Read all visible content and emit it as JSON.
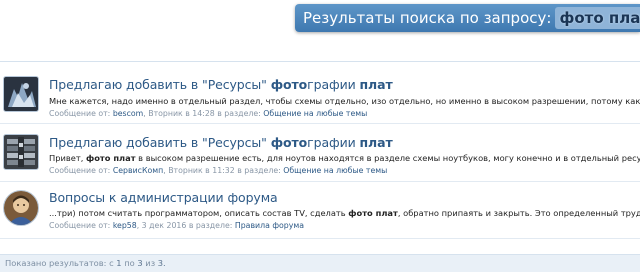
{
  "header": {
    "title_prefix": "Результаты поиска по запросу:",
    "query": "фото плат"
  },
  "results": [
    {
      "title_parts": [
        "Предлагаю добавить в \"Ресурсы\" ",
        "фото",
        "графии ",
        "плат"
      ],
      "snippet_parts": [
        "Мне кажется, надо именно в отдельный раздел, чтобы схемы отдельно, изо отдельно, но именно в высоком разрешении, потому как в плохом качест"
      ],
      "meta": {
        "message_from_label": "Сообщение от:",
        "author": "bescom",
        "date": ", Вторник в 14:28",
        "section_label": "в разделе:",
        "forum": "Общение на любые темы"
      }
    },
    {
      "title_parts": [
        "Предлагаю добавить в \"Ресурсы\" ",
        "фото",
        "графии ",
        "плат"
      ],
      "snippet_parts": [
        "Привет, ",
        "фото плат",
        " в высоком разрешение есть, для ноутов находятся в разделе схемы ноутбуков, могу конечно и в отдельный ресурс вынести, как т"
      ],
      "meta": {
        "message_from_label": "Сообщение от:",
        "author": "СервисКомп",
        "date": ", Вторник в 11:32",
        "section_label": "в разделе:",
        "forum": "Общение на любые темы"
      }
    },
    {
      "title_parts": [
        "Вопросы к администрации форума"
      ],
      "snippet_parts": [
        "...три) потом считать программатором, описать состав TV, сделать ",
        "фото плат",
        ", обратно припаять и закрыть. Это определенный труд и просто так их..."
      ],
      "meta": {
        "message_from_label": "Сообщение от:",
        "author": "kep58",
        "date": ", 3 дек 2016",
        "section_label": "в разделе:",
        "forum": "Правила форума"
      }
    }
  ],
  "footer": {
    "label": "Показано результатов:",
    "from": "1",
    "to_word": "по",
    "to": "3",
    "of_word": "из",
    "total": "3",
    "from_prefix": "с"
  },
  "colors": {
    "header_bg": "#4a84bb",
    "link": "#2d5986",
    "meta": "#8896a6",
    "footer_bg": "#e9f0f7"
  },
  "icons": {
    "avatar_1": "dark-figure-avatar",
    "avatar_2": "circuit-board-avatar",
    "avatar_3": "person-portrait-avatar"
  }
}
